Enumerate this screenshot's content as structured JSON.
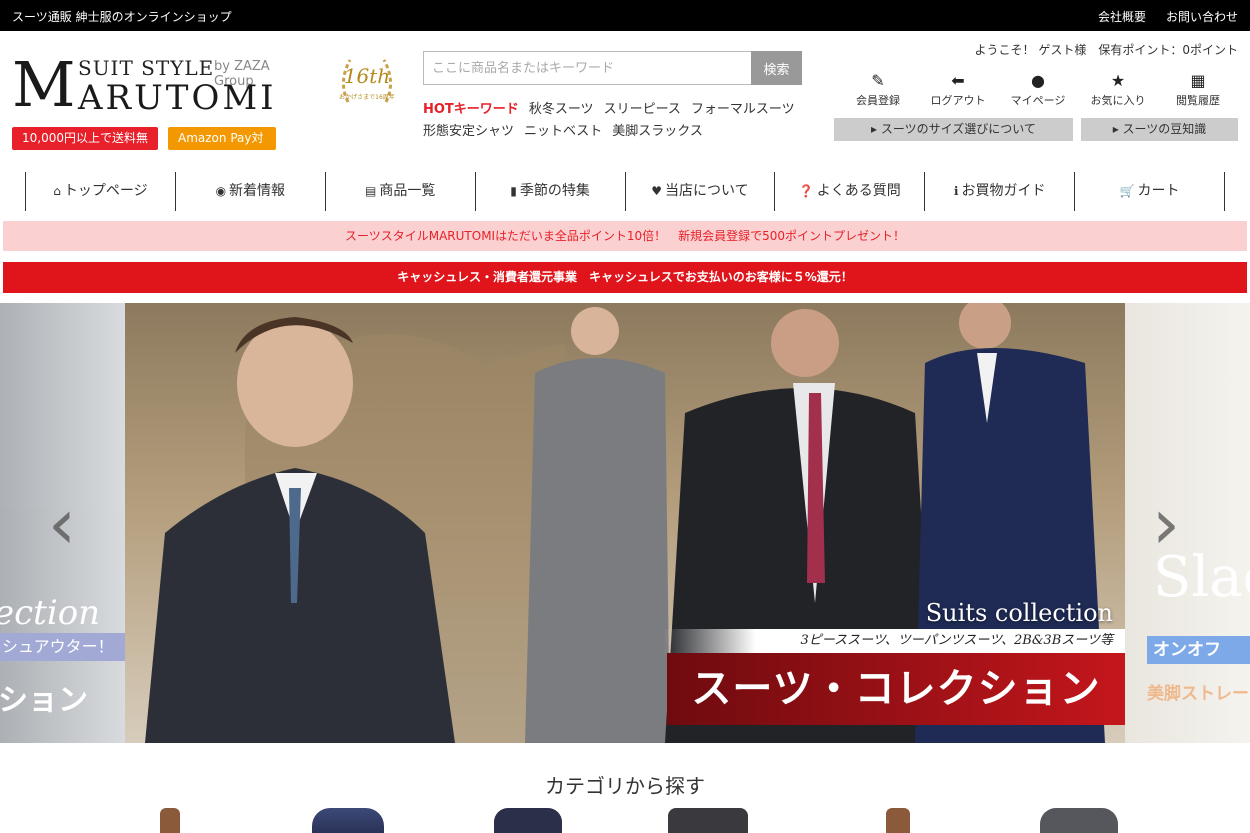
{
  "topbar": {
    "tagline": "スーツ通販 紳士服のオンラインショップ",
    "company": "会社概要",
    "contact": "お問い合わせ"
  },
  "logo": {
    "suit_style": "SUIT STYLE",
    "by": "by ZAZA Group",
    "m": "M",
    "rutomi": "ARUTOMI",
    "anniv_num": "16th",
    "anniv_sub": "おかげさまで16周年"
  },
  "pills": {
    "free_shipping": "10,000円以上で送料無料",
    "amazon_pay": "Amazon Pay対応"
  },
  "search": {
    "placeholder": "ここに商品名またはキーワード",
    "button": "検索"
  },
  "hot_keywords": {
    "label": "HOTキーワード",
    "items": [
      "秋冬スーツ",
      "スリーピース",
      "フォーマルスーツ",
      "形態安定シャツ",
      "ニットベスト",
      "美脚スラックス"
    ]
  },
  "user": {
    "welcome": "ようこそ！ ゲスト様　保有ポイント：0ポイント",
    "icons": [
      {
        "label": "会員登録",
        "icon": "pencil-icon"
      },
      {
        "label": "ログアウト",
        "icon": "logout-arrow-icon"
      },
      {
        "label": "マイページ",
        "icon": "person-icon"
      },
      {
        "label": "お気に入り",
        "icon": "star-icon"
      },
      {
        "label": "閲覧履歴",
        "icon": "calendar-icon"
      }
    ],
    "size_guide": "▸ スーツのサイズ選びについて",
    "trivia": "▸ スーツの豆知識"
  },
  "nav": [
    {
      "label": "トップページ",
      "icon": "home-icon"
    },
    {
      "label": "新着情報",
      "icon": "circle-dot-icon"
    },
    {
      "label": "商品一覧",
      "icon": "list-icon"
    },
    {
      "label": "季節の特集",
      "icon": "book-icon"
    },
    {
      "label": "当店について",
      "icon": "heart-icon"
    },
    {
      "label": "よくある質問",
      "icon": "question-icon"
    },
    {
      "label": "お買物ガイド",
      "icon": "info-icon"
    },
    {
      "label": "カート",
      "icon": "cart-icon"
    }
  ],
  "banners": {
    "points": "スーツスタイルMARUTOMIはただいま全品ポイント10倍！　新規会員登録で500ポイントプレゼント！",
    "cashless": "キャッシュレス・消費者還元事業　キャッシュレスでお支払いのお客様に５%還元！"
  },
  "hero": {
    "left_en": "ection",
    "left_tag": "シュアウター！",
    "left_jp": "ション",
    "main_en": "Suits collection",
    "main_sub": "3ピーススーツ、ツーパンツスーツ、2B&3Bスーツ等",
    "main_jp": "スーツ・コレクション",
    "right_en": "Slac",
    "right_tag": "オンオフ",
    "right_jp": "美脚ストレー",
    "prev": "‹",
    "next": "›"
  },
  "category": {
    "title": "カテゴリから探す"
  },
  "colors": {
    "accent_red": "#e8202a",
    "amazon_orange": "#f39800",
    "banner_pink": "#fbd0d0",
    "banner_red": "#e0141b"
  }
}
